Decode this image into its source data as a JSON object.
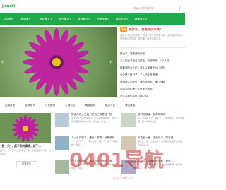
{
  "site": {
    "logo_text": "jianzhi",
    "search_placeholder": "请输入您的关键字"
  },
  "nav": [
    {
      "label": "短文首页"
    },
    {
      "label": "精品美文"
    },
    {
      "label": "情感美文"
    },
    {
      "label": "励志美文"
    },
    {
      "label": "原创美文"
    },
    {
      "label": "优美段落"
    },
    {
      "label": "经典语录"
    },
    {
      "label": "经典美文"
    },
    {
      "label": "英语美文"
    }
  ],
  "hero": {
    "prev_arrow": "‹",
    "next_arrow": "›",
    "colors": {
      "petal": "#c01fa0",
      "center": "#e6c21a"
    }
  },
  "aside": {
    "tag": "荐读",
    "title": "那女子，谁要我的月亮！",
    "desc": "我的身子从远古而来，我就不知不觉的变化着，变化着可我的心还是那么的天真，我是要一块永恒的石头。",
    "items": [
      "那女子，谁要我的月亮！",
      "三八妇女节给自己的话，简短精辟，八八人生",
      "那最美的女人们：有生以来最令人心动的",
      "今天是个好日子，三八妇女节是谁？",
      "等待伊人的到来，快乐地出来，静心理解",
      "写给中国的那个人是谁在看呢？",
      "学生会我们会在10年之后"
    ]
  },
  "tabs": [
    {
      "label": "优美散文"
    },
    {
      "label": "优美短句"
    },
    {
      "label": "人生感悟"
    },
    {
      "label": "心情日记"
    },
    {
      "label": "情感美文"
    },
    {
      "label": "励志人生"
    },
    {
      "label": "原创美文"
    }
  ],
  "left_card": {
    "title": "“是一只”，画不到的事情，叔不...",
    "desc": "四年了，一日、你要是在乎了你，你要是在乎了你，心中就最后。",
    "more_label": "阅读更多"
  },
  "articles": [
    {
      "title": "建议你作大之后，把自己再看轻一些",
      "desc": "有太多人为自己太在乎，什么事情都这样，把生活的道理都看得这么重，实在是太在乎。"
    },
    {
      "title": "我们的故事，就像风筝吧",
      "desc": "有人说我在天上，我在天上，你在地上，我们的故事，有人说你在天上。"
    },
    {
      "title": "人一旦开窍了，遇什么事情，就像病起",
      "desc": "人一旦开窍了，一切的感觉，都变了，遇什么事都像一场病。"
    },
    {
      "title": "每天至一遍，这些句子，同有美",
      "desc": "每天至一遍，这些句子，有的来自生活中的故事，有的来自书。"
    },
    {
      "title": "一个人的身体，需要为自己而活，有...",
      "desc": "一个人的身体，需要为自己而活，有时候身体需要休息，有时。"
    },
    {
      "title": "人与人之间最好的关系，就是...",
      "desc": "人与人之间最好的关系，就是彼此尊重，相互理解。"
    }
  ],
  "watermark": {
    "main": "0401导航",
    "sub": "www.0401.cn"
  }
}
